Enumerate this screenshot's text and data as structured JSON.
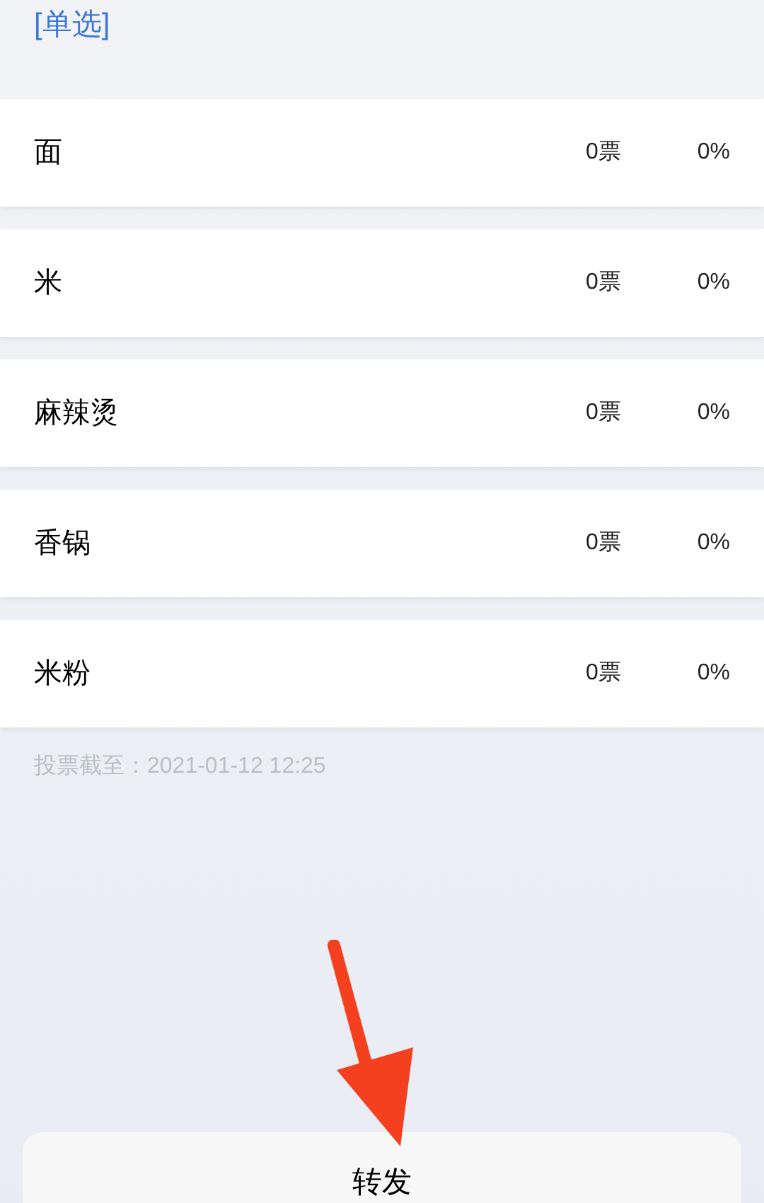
{
  "vote_type": "[单选]",
  "options": [
    {
      "name": "面",
      "votes": "0票",
      "percent": "0%"
    },
    {
      "name": "米",
      "votes": "0票",
      "percent": "0%"
    },
    {
      "name": "麻辣烫",
      "votes": "0票",
      "percent": "0%"
    },
    {
      "name": "香锅",
      "votes": "0票",
      "percent": "0%"
    },
    {
      "name": "米粉",
      "votes": "0票",
      "percent": "0%"
    }
  ],
  "deadline": "投票截至：2021-01-12 12:25",
  "sheet": {
    "button": "转发"
  }
}
